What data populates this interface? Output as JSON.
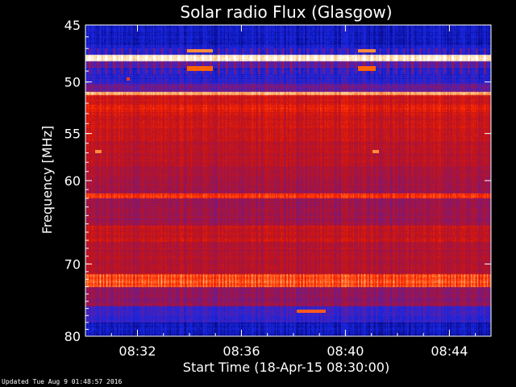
{
  "chart_data": {
    "type": "heatmap",
    "title": "Solar radio Flux (Glasgow)",
    "xlabel": "Start Time (18-Apr-15 08:30:00)",
    "ylabel": "Frequency [MHz]",
    "x_range_minutes": [
      0,
      15.6
    ],
    "y_range_mhz": [
      45,
      80
    ],
    "y_scale": "log",
    "x_ticks": [
      {
        "label": "08:32",
        "minutes": 2
      },
      {
        "label": "08:36",
        "minutes": 6
      },
      {
        "label": "08:40",
        "minutes": 10
      },
      {
        "label": "08:44",
        "minutes": 14
      }
    ],
    "y_ticks": [
      {
        "label": "45",
        "mhz": 45
      },
      {
        "label": "50",
        "mhz": 50
      },
      {
        "label": "55",
        "mhz": 55
      },
      {
        "label": "60",
        "mhz": 60
      },
      {
        "label": "70",
        "mhz": 70
      },
      {
        "label": "80",
        "mhz": 80
      }
    ],
    "colormap": [
      "#000014",
      "#0a0a8c",
      "#1428e6",
      "#5a1eaa",
      "#a01446",
      "#c81414",
      "#ff2800",
      "#ff8c3c",
      "#ffe6b4",
      "#ffffff"
    ],
    "legend": "none",
    "grid": false
  },
  "footer": "Updated Tue Aug  9 01:48:57 2016"
}
